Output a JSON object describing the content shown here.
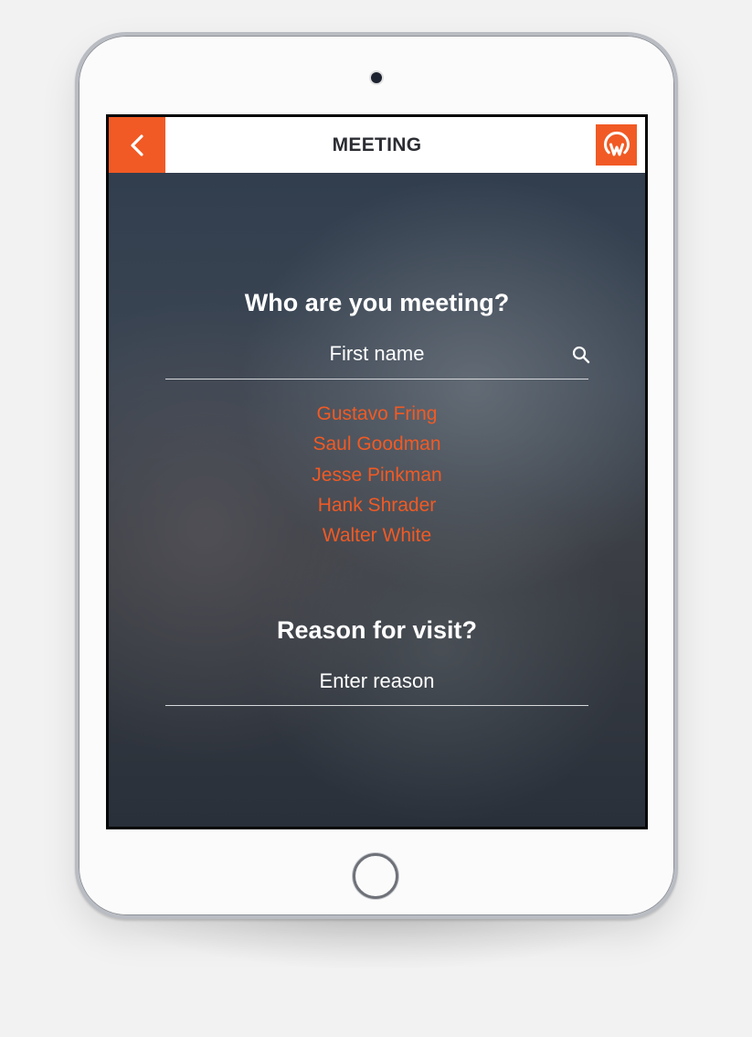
{
  "header": {
    "title": "MEETING",
    "back_icon": "chevron-left-icon",
    "logo_icon": "w-logo-icon",
    "accent_color": "#f15a24"
  },
  "meeting": {
    "heading": "Who are you meeting?",
    "search_placeholder": "First name",
    "search_icon": "search-icon",
    "results": [
      "Gustavo Fring",
      "Saul Goodman",
      "Jesse Pinkman",
      "Hank Shrader",
      "Walter White"
    ]
  },
  "reason": {
    "heading": "Reason for visit?",
    "placeholder": "Enter reason"
  },
  "device": {
    "camera_icon": "camera-icon",
    "home_button_icon": "home-button-icon"
  }
}
